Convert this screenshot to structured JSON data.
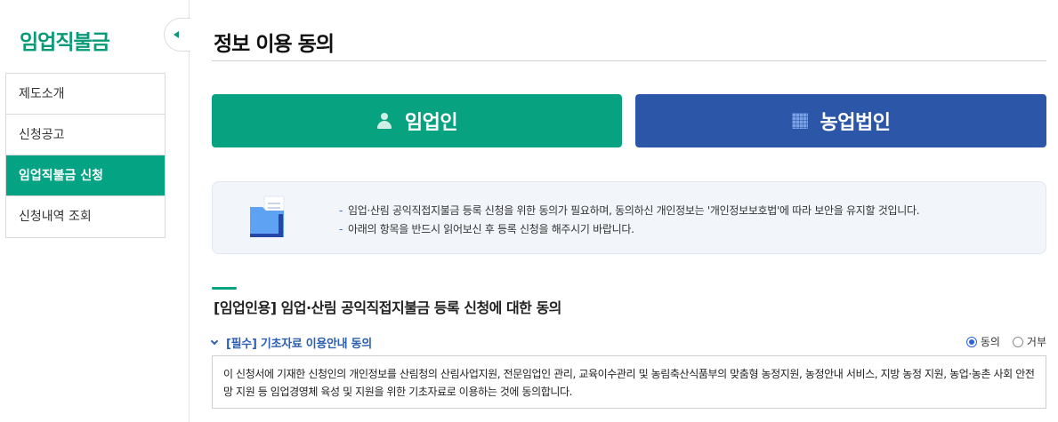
{
  "sidebar": {
    "title": "임업직불금",
    "items": [
      {
        "label": "제도소개",
        "active": false
      },
      {
        "label": "신청공고",
        "active": false
      },
      {
        "label": "임업직불금 신청",
        "active": true
      },
      {
        "label": "신청내역 조회",
        "active": false
      }
    ],
    "collapse_icon": "chevron-left-icon"
  },
  "main": {
    "page_title": "정보 이용 동의",
    "type_buttons": {
      "person_label": "임업인",
      "person_icon": "person-icon",
      "corp_label": "농업법인",
      "corp_icon": "building-icon"
    },
    "notice": {
      "icon": "folder-document-icon",
      "bullet": "-",
      "lines": [
        "임업·산림 공익직접지불금 등록 신청을 위한 동의가 필요하며, 동의하신 개인정보는 '개인정보보호법'에 따라 보안을 유지할 것입니다.",
        "아래의 항목을 반드시 읽어보신 후 등록 신청을 해주시기 바랍니다."
      ]
    },
    "section_title": "[임업인용] 임업·산림 공익직접지불금 등록 신청에 대한 동의",
    "subsection": {
      "title": "[필수] 기초자료 이용안내 동의",
      "agree_label": "동의",
      "disagree_label": "거부",
      "selected": "동의",
      "text": "이 신청서에 기재한 신청인의 개인정보를 산림청의 산림사업지원, 전문임업인 관리, 교육이수관리 및 농림축산식품부의 맞춤형 농정지원, 농정안내 서비스, 지방 농정 지원, 농업·농촌 사회 안전망 지원 등 임업경영체 육성 및 지원을 위한 기초자료로 이용하는 것에 동의합니다."
    }
  },
  "colors": {
    "primary_green": "#07a27f",
    "primary_blue": "#2c57a8",
    "accent_blue_text": "#2d5fb0"
  }
}
